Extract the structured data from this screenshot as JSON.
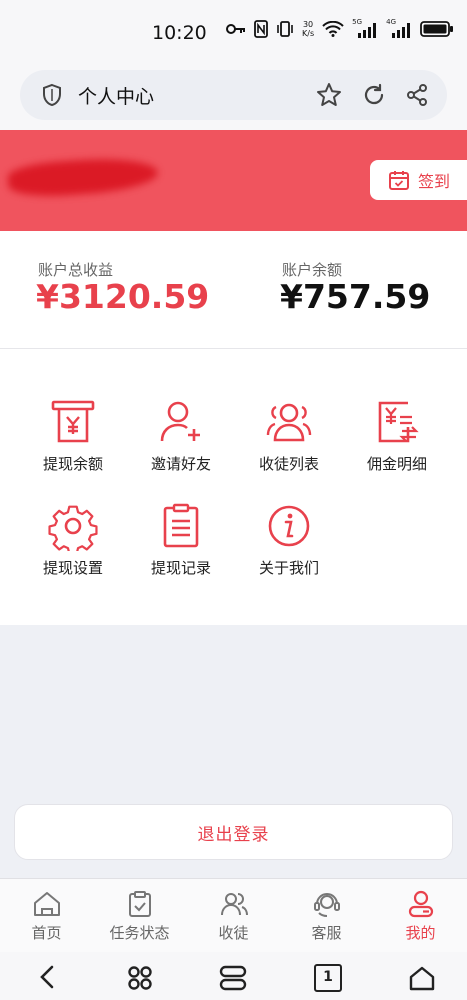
{
  "status_bar": {
    "time": "10:20",
    "speed_top": "30",
    "speed_bottom": "K/s",
    "sim1": "5G",
    "sim2": "4G",
    "icons": [
      "key-icon",
      "nfc-icon",
      "vibrate-icon",
      "wifi-icon",
      "signal-icon",
      "battery-icon"
    ]
  },
  "browser": {
    "title": "个人中心",
    "icons": [
      "shield-icon",
      "star-icon",
      "refresh-icon",
      "share-icon"
    ]
  },
  "header": {
    "checkin_label": "签到",
    "colors": {
      "header_bg": "#f0545e",
      "accent": "#e8414c"
    }
  },
  "balance": {
    "total_label": "账户总收益",
    "total_value": "¥3120.59",
    "balance_label": "账户余额",
    "balance_value": "¥757.59"
  },
  "menu": {
    "items": [
      {
        "label": "提现余额",
        "icon": "withdraw-icon"
      },
      {
        "label": "邀请好友",
        "icon": "add-user-icon"
      },
      {
        "label": "收徒列表",
        "icon": "users-icon"
      },
      {
        "label": "佣金明细",
        "icon": "commission-icon"
      },
      {
        "label": "提现设置",
        "icon": "gear-icon"
      },
      {
        "label": "提现记录",
        "icon": "clipboard-icon"
      },
      {
        "label": "关于我们",
        "icon": "info-icon"
      }
    ]
  },
  "logout": {
    "label": "退出登录"
  },
  "tabbar": {
    "items": [
      {
        "label": "首页",
        "icon": "home-icon"
      },
      {
        "label": "任务状态",
        "icon": "task-icon"
      },
      {
        "label": "收徒",
        "icon": "users-icon"
      },
      {
        "label": "客服",
        "icon": "headset-icon"
      },
      {
        "label": "我的",
        "icon": "profile-icon",
        "active": true
      }
    ]
  },
  "system_nav": {
    "tab_count": "1",
    "icons": [
      "back-icon",
      "multitask-icon",
      "tabs-overview-icon",
      "tab-count-icon",
      "home-icon"
    ]
  }
}
